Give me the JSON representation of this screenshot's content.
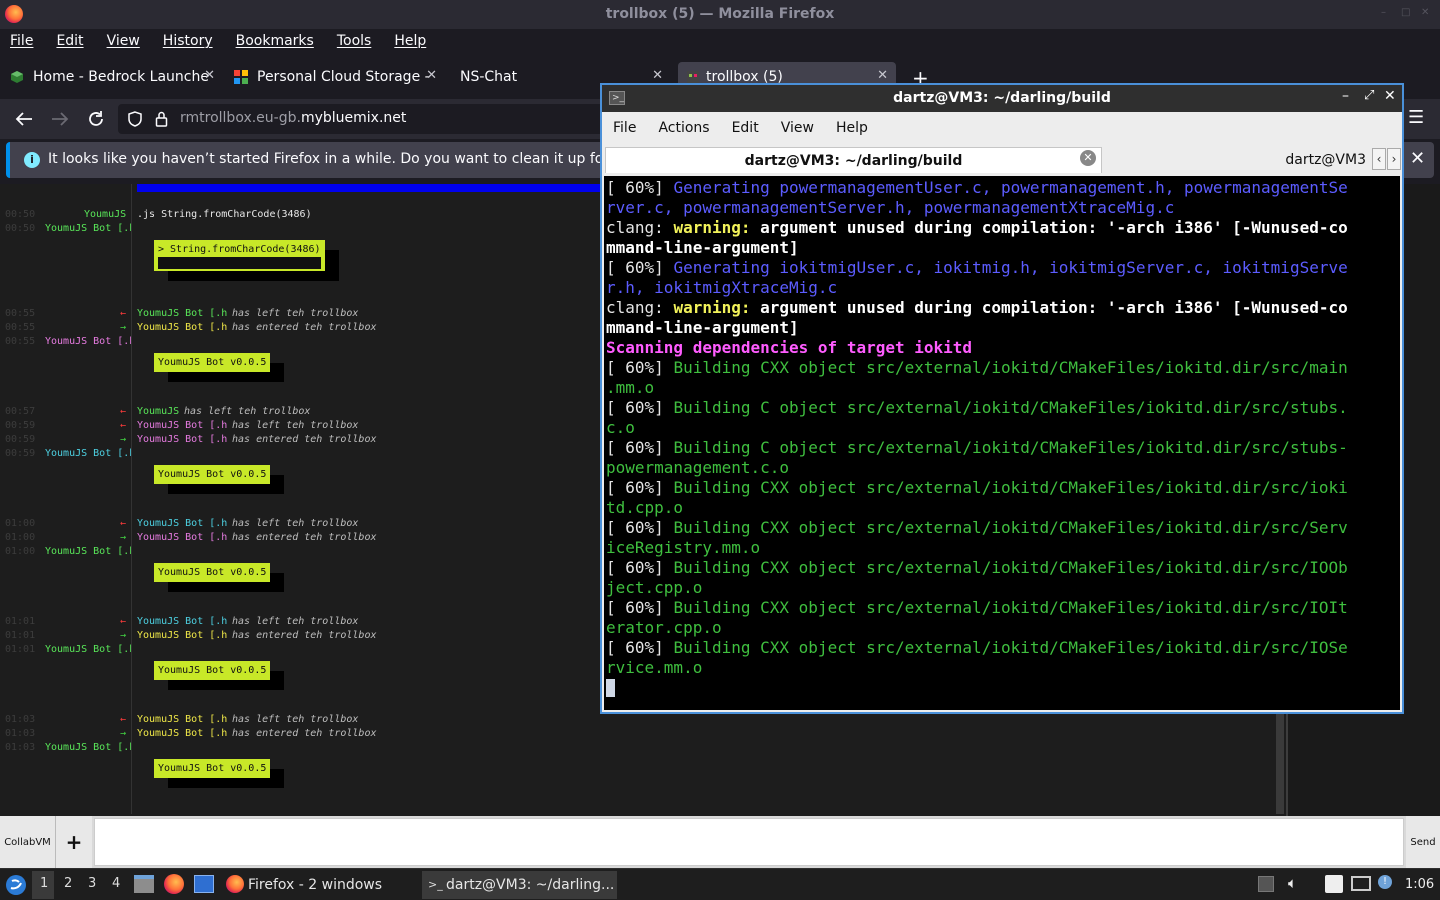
{
  "firefox": {
    "title": "trollbox (5) — Mozilla Firefox",
    "menu": [
      "File",
      "Edit",
      "View",
      "History",
      "Bookmarks",
      "Tools",
      "Help"
    ],
    "tabs": [
      {
        "label": "Home - Bedrock Launche",
        "favicon": "bedrock-icon",
        "active": false
      },
      {
        "label": "Personal Cloud Storage -",
        "favicon": "grid-icon",
        "active": false
      },
      {
        "label": "NS-Chat",
        "favicon": "",
        "active": false
      },
      {
        "label": "trollbox (5)",
        "favicon": "trollbox-icon",
        "active": true
      }
    ],
    "url_prefix": "rmtrollbox.eu-gb.",
    "url_domain": "mybluemix.net",
    "notification": "It looks like you haven’t started Firefox in a while. Do you want to clean it up for a f"
  },
  "chat": {
    "lines": [
      {
        "time": "00:50",
        "nick": "YoumuJS",
        "text": ".js String.fromCharCode(3486)",
        "kind": "msg"
      },
      {
        "time": "00:50",
        "nick": "YoumuJS Bot [.h",
        "text": "",
        "kind": "bot"
      },
      {
        "time": "00:55",
        "nick": "YoumuJS Bot [.h",
        "text": "has left teh trollbox",
        "kind": "leave"
      },
      {
        "time": "00:55",
        "nick": "YoumuJS Bot [.h",
        "text": "has entered teh trollbox",
        "kind": "enter"
      },
      {
        "time": "00:55",
        "nick": "YoumuJS Bot [.h",
        "text": "",
        "kind": "bot"
      },
      {
        "time": "00:57",
        "nick": "YoumuJS",
        "text": "has left teh trollbox",
        "kind": "leave"
      },
      {
        "time": "00:59",
        "nick": "YoumuJS Bot [.h",
        "text": "has left teh trollbox",
        "kind": "leave"
      },
      {
        "time": "00:59",
        "nick": "YoumuJS Bot [.h",
        "text": "has entered teh trollbox",
        "kind": "enter"
      },
      {
        "time": "00:59",
        "nick": "YoumuJS Bot [.h",
        "text": "",
        "kind": "bot"
      },
      {
        "time": "01:00",
        "nick": "YoumuJS Bot [.h",
        "text": "has left teh trollbox",
        "kind": "leave"
      },
      {
        "time": "01:00",
        "nick": "YoumuJS Bot [.h",
        "text": "has entered teh trollbox",
        "kind": "enter"
      },
      {
        "time": "01:00",
        "nick": "YoumuJS Bot [.h",
        "text": "",
        "kind": "bot"
      },
      {
        "time": "01:01",
        "nick": "YoumuJS Bot [.h",
        "text": "has left teh trollbox",
        "kind": "leave"
      },
      {
        "time": "01:01",
        "nick": "YoumuJS Bot [.h",
        "text": "has entered teh trollbox",
        "kind": "enter"
      },
      {
        "time": "01:01",
        "nick": "YoumuJS Bot [.h",
        "text": "",
        "kind": "bot"
      },
      {
        "time": "01:03",
        "nick": "YoumuJS Bot [.h",
        "text": "has left teh trollbox",
        "kind": "leave"
      },
      {
        "time": "01:03",
        "nick": "YoumuJS Bot [.h",
        "text": "has entered teh trollbox",
        "kind": "enter"
      },
      {
        "time": "01:03",
        "nick": "YoumuJS Bot [.h",
        "text": "",
        "kind": "bot"
      }
    ],
    "bot_boxes": [
      "> String.fromCharCode(3486)",
      "YoumuJS Bot v0.0.5",
      "YoumuJS Bot v0.0.5",
      "YoumuJS Bot v0.0.5",
      "YoumuJS Bot v0.0.5",
      "YoumuJS Bot v0.0.5"
    ],
    "room_label": "CollabVM",
    "add_label": "+",
    "send_label": "Send"
  },
  "terminal": {
    "title": "dartz@VM3: ~/darling/build",
    "menu": [
      "File",
      "Actions",
      "Edit",
      "View",
      "Help"
    ],
    "tab_active": "dartz@VM3: ~/darling/build",
    "tab_second": "dartz@VM3",
    "lines": [
      [
        {
          "c": "",
          "t": "[ 60%] "
        },
        {
          "c": "t-blue",
          "t": "Generating powermanagementUser.c, powermanagement.h, powermanagementSe"
        }
      ],
      [
        {
          "c": "t-blue",
          "t": "rver.c, powermanagementServer.h, powermanagementXtraceMig.c"
        }
      ],
      [
        {
          "c": "",
          "t": "clang: "
        },
        {
          "c": "t-yel",
          "t": "warning: "
        },
        {
          "c": "t-white",
          "t": "argument unused during compilation: '-arch i386' [-Wunused-co"
        }
      ],
      [
        {
          "c": "t-white",
          "t": "mmand-line-argument]"
        }
      ],
      [
        {
          "c": "",
          "t": "[ 60%] "
        },
        {
          "c": "t-blue",
          "t": "Generating iokitmigUser.c, iokitmig.h, iokitmigServer.c, iokitmigServe"
        }
      ],
      [
        {
          "c": "t-blue",
          "t": "r.h, iokitmigXtraceMig.c"
        }
      ],
      [
        {
          "c": "",
          "t": "clang: "
        },
        {
          "c": "t-yel",
          "t": "warning: "
        },
        {
          "c": "t-white",
          "t": "argument unused during compilation: '-arch i386' [-Wunused-co"
        }
      ],
      [
        {
          "c": "t-white",
          "t": "mmand-line-argument]"
        }
      ],
      [
        {
          "c": "t-mag",
          "t": "Scanning dependencies of target iokitd"
        }
      ],
      [
        {
          "c": "",
          "t": "[ 60%] "
        },
        {
          "c": "t-green",
          "t": "Building CXX object src/external/iokitd/CMakeFiles/iokitd.dir/src/main"
        }
      ],
      [
        {
          "c": "t-green",
          "t": ".mm.o"
        }
      ],
      [
        {
          "c": "",
          "t": "[ 60%] "
        },
        {
          "c": "t-green",
          "t": "Building C object src/external/iokitd/CMakeFiles/iokitd.dir/src/stubs."
        }
      ],
      [
        {
          "c": "t-green",
          "t": "c.o"
        }
      ],
      [
        {
          "c": "",
          "t": "[ 60%] "
        },
        {
          "c": "t-green",
          "t": "Building C object src/external/iokitd/CMakeFiles/iokitd.dir/src/stubs-"
        }
      ],
      [
        {
          "c": "t-green",
          "t": "powermanagement.c.o"
        }
      ],
      [
        {
          "c": "",
          "t": "[ 60%] "
        },
        {
          "c": "t-green",
          "t": "Building CXX object src/external/iokitd/CMakeFiles/iokitd.dir/src/ioki"
        }
      ],
      [
        {
          "c": "t-green",
          "t": "td.cpp.o"
        }
      ],
      [
        {
          "c": "",
          "t": "[ 60%] "
        },
        {
          "c": "t-green",
          "t": "Building CXX object src/external/iokitd/CMakeFiles/iokitd.dir/src/Serv"
        }
      ],
      [
        {
          "c": "t-green",
          "t": "iceRegistry.mm.o"
        }
      ],
      [
        {
          "c": "",
          "t": "[ 60%] "
        },
        {
          "c": "t-green",
          "t": "Building CXX object src/external/iokitd/CMakeFiles/iokitd.dir/src/IOOb"
        }
      ],
      [
        {
          "c": "t-green",
          "t": "ject.cpp.o"
        }
      ],
      [
        {
          "c": "",
          "t": "[ 60%] "
        },
        {
          "c": "t-green",
          "t": "Building CXX object src/external/iokitd/CMakeFiles/iokitd.dir/src/IOIt"
        }
      ],
      [
        {
          "c": "t-green",
          "t": "erator.cpp.o"
        }
      ],
      [
        {
          "c": "",
          "t": "[ 60%] "
        },
        {
          "c": "t-green",
          "t": "Building CXX object src/external/iokitd/CMakeFiles/iokitd.dir/src/IOSe"
        }
      ],
      [
        {
          "c": "t-green",
          "t": "rvice.mm.o"
        }
      ]
    ]
  },
  "taskbar": {
    "desktops": [
      "1",
      "2",
      "3",
      "4"
    ],
    "firefox_button": "Firefox - 2 windows",
    "terminal_button": "dartz@VM3: ~/darling...",
    "clock": "1:06"
  },
  "colors": {
    "accent": "#4a90d9",
    "firefox_bg": "#1c1b22",
    "bot_box": "#c8e828",
    "terminal_green": "#3fbf3f",
    "terminal_blue": "#5c5cff"
  }
}
